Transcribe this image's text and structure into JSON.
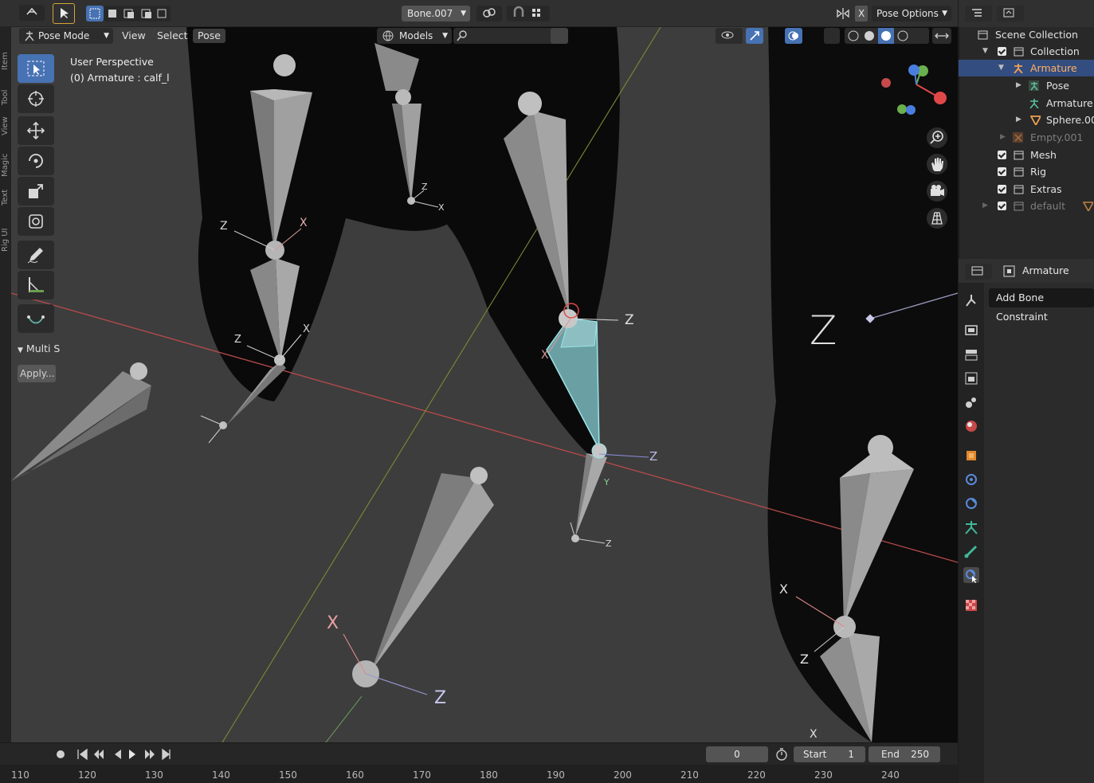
{
  "header": {
    "bone_name": "Bone.007",
    "pose_options_label": "Pose Options",
    "x_mirror_label": "X"
  },
  "mode_bar": {
    "mode_label": "Pose Mode",
    "menus": [
      "View",
      "Select",
      "Pose"
    ],
    "filter_label": "Models"
  },
  "viewport": {
    "view_name": "User Perspective",
    "context": "(0) Armature : calf_l",
    "axis_labels": {
      "z": "Z",
      "x": "X",
      "y": "Y"
    }
  },
  "toolbar": {
    "tools": [
      "select-box",
      "cursor",
      "move",
      "rotate",
      "scale",
      "transform",
      "annotate",
      "measure",
      "relax"
    ],
    "active_tool": "select-box",
    "panel_title": "Multi S",
    "apply_label": "Apply..."
  },
  "left_tabs": [
    "Item",
    "Tool",
    "View",
    "Magic",
    "Text",
    "Rig UI"
  ],
  "timeline": {
    "current_frame": "0",
    "start_label": "Start",
    "start_value": "1",
    "end_label": "End",
    "end_value": "250",
    "ruler_ticks": [
      "110",
      "120",
      "130",
      "140",
      "150",
      "160",
      "170",
      "180",
      "190",
      "200",
      "210",
      "220",
      "230",
      "240"
    ]
  },
  "outliner": {
    "rows": [
      {
        "label": "Scene Collection",
        "icon": "scene-collection-icon"
      },
      {
        "label": "Collection",
        "icon": "collection-icon"
      },
      {
        "label": "Armature",
        "icon": "armature-icon",
        "selected": true
      },
      {
        "label": "Pose",
        "icon": "pose-icon"
      },
      {
        "label": "Armature",
        "icon": "armature-data-icon"
      },
      {
        "label": "Sphere.00",
        "icon": "mesh-icon"
      },
      {
        "label": "Empty.001",
        "icon": "empty-icon"
      },
      {
        "label": "Mesh",
        "icon": "collection-icon"
      },
      {
        "label": "Rig",
        "icon": "collection-icon"
      },
      {
        "label": "Extras",
        "icon": "collection-icon"
      },
      {
        "label": "default",
        "icon": "collection-icon"
      }
    ]
  },
  "properties": {
    "header_label": "Armature",
    "tooltip": "Add Bone Constraint",
    "tabs": [
      "tool-icon",
      "render-icon",
      "output-icon",
      "view-layer-icon",
      "scene-icon",
      "world-icon",
      "object-icon",
      "modifier-icon",
      "physics-icon",
      "object-data-icon",
      "bone-icon",
      "bone-constraint-icon",
      "texture-icon"
    ]
  },
  "colors": {
    "accent": "#4772b3",
    "selected_bone": "#7ec8c8",
    "x_axis": "#c8504f",
    "y_axis": "#8a9a3c",
    "bone": "#8e8e8e"
  }
}
